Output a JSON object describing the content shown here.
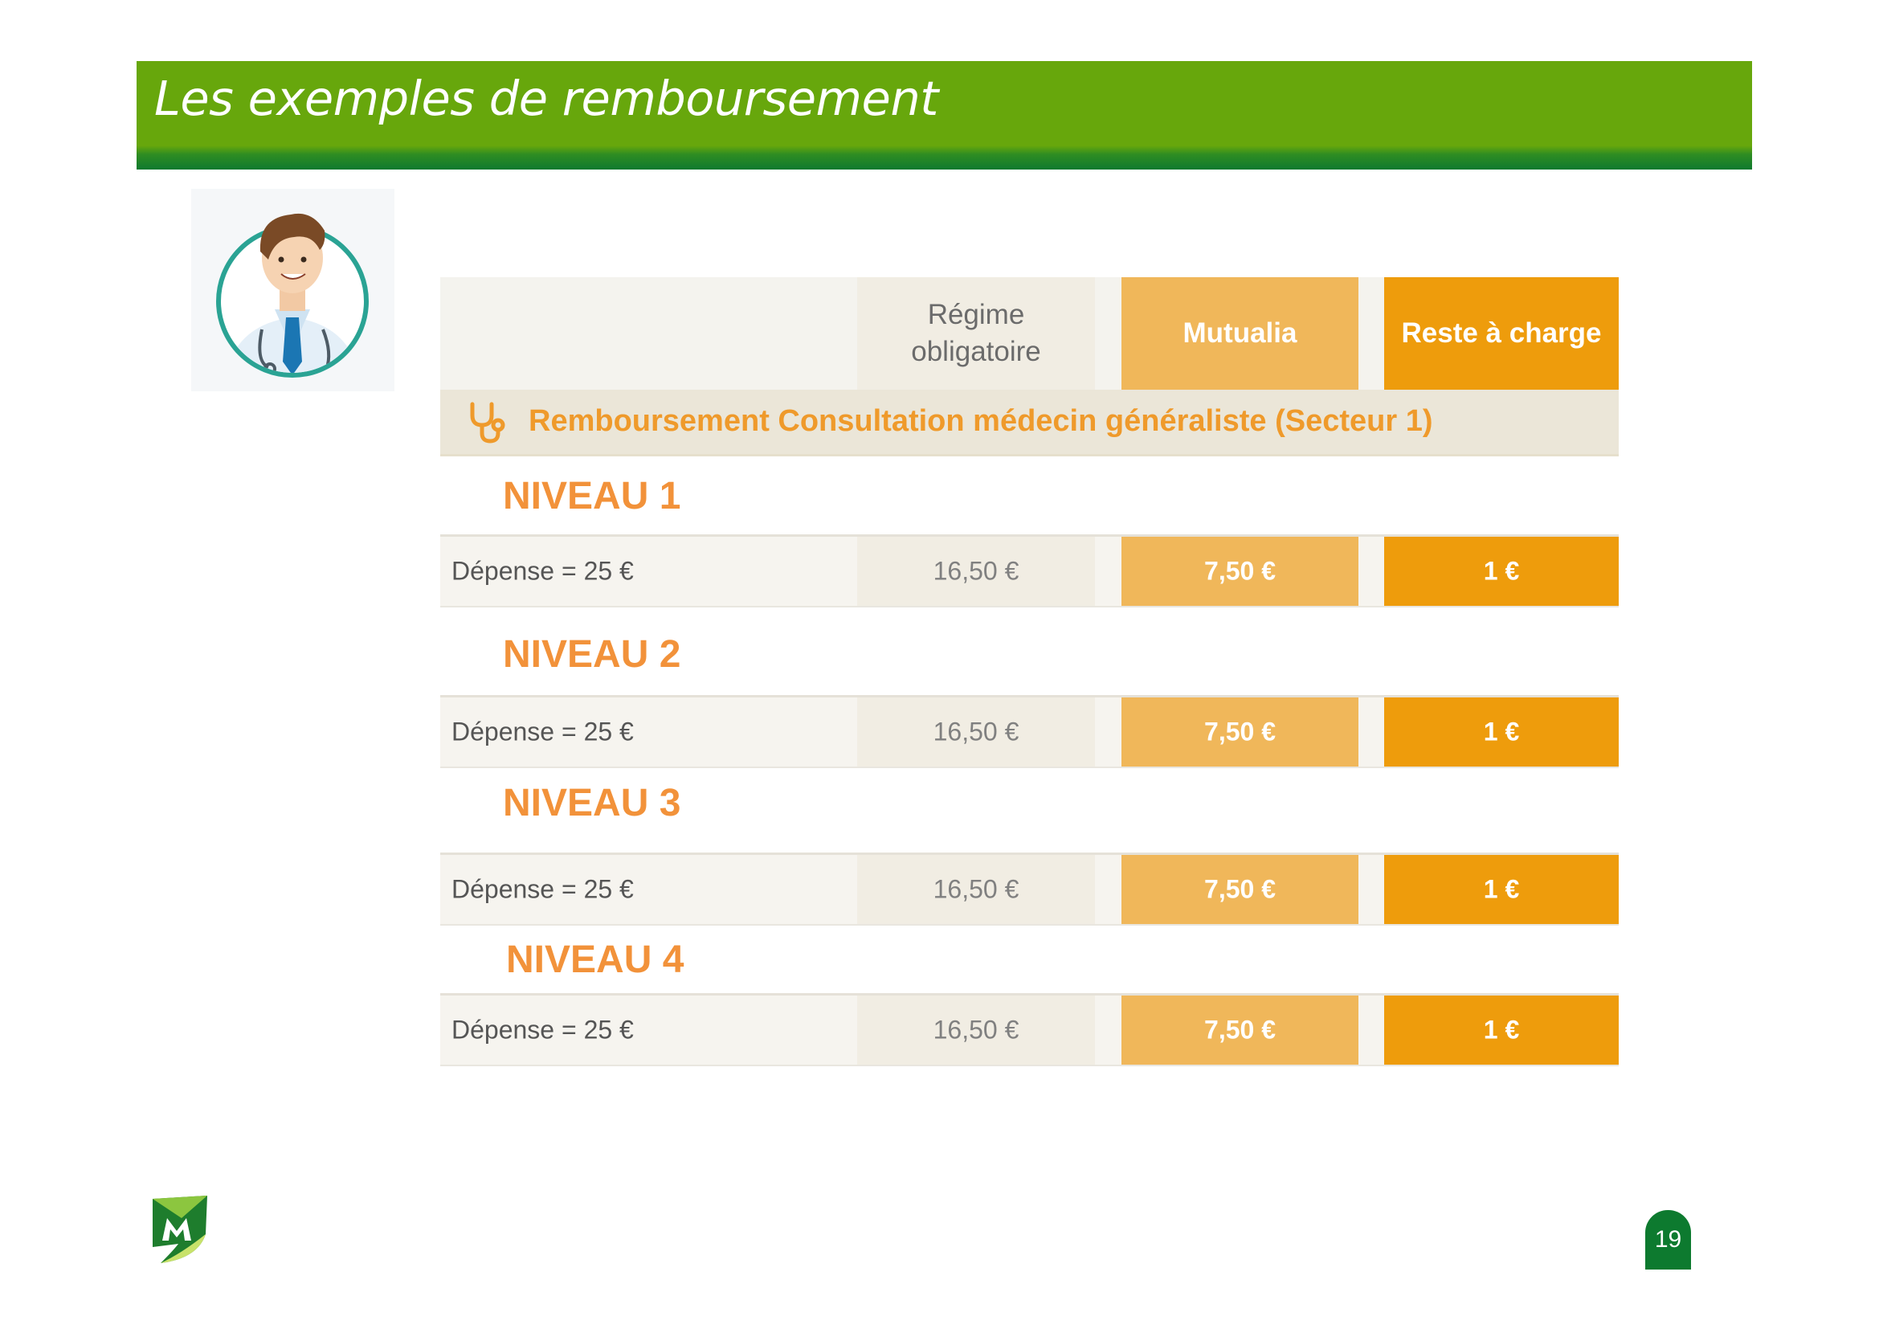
{
  "title": "Les exemples de remboursement",
  "header": {
    "regime_line1": "Régime",
    "regime_line2": "obligatoire",
    "mutualia": "Mutualia",
    "reste": "Reste à charge"
  },
  "section": {
    "icon": "stethoscope-icon",
    "title": "Remboursement Consultation médecin généraliste (Secteur 1)"
  },
  "levels": [
    {
      "name": "NIVEAU 1",
      "label": "Dépense = 25 €",
      "regime": "16,50 €",
      "mutualia": "7,50 €",
      "reste": "1 €"
    },
    {
      "name": "NIVEAU 2",
      "label": "Dépense = 25 €",
      "regime": "16,50 €",
      "mutualia": "7,50 €",
      "reste": "1 €"
    },
    {
      "name": "NIVEAU 3",
      "label": "Dépense = 25 €",
      "regime": "16,50 €",
      "mutualia": "7,50 €",
      "reste": "1 €"
    },
    {
      "name": "NIVEAU 4",
      "label": "Dépense = 25 €",
      "regime": "16,50 €",
      "mutualia": "7,50 €",
      "reste": "1 €"
    }
  ],
  "page_number": "19",
  "colors": {
    "title_bar": "#67a70c",
    "accent_orange": "#f2923a",
    "mutualia_cell": "#f0b75a",
    "reste_cell": "#ee9c0c"
  }
}
